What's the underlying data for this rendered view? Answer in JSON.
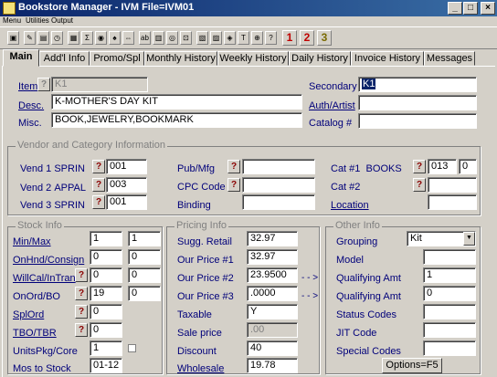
{
  "window": {
    "title": "Bookstore Manager - IVM    File=IVM01",
    "min": "_",
    "max": "□",
    "close": "×"
  },
  "menu": [
    "Menu",
    "Utilities",
    "Output"
  ],
  "toolbar": {
    "icons": [
      "save-icon",
      "print-icon",
      "folder-icon",
      "clock-icon",
      "grid-icon",
      "sum-icon",
      "camera-icon",
      "binoculars-icon",
      "arrows-icon",
      "abc-icon",
      "table-icon",
      "target-icon",
      "lock-icon",
      "chart-icon",
      "image-icon",
      "tag-icon",
      "text-icon",
      "circle-icon",
      "help-icon"
    ],
    "numbers": [
      "1",
      "2",
      "3"
    ],
    "glyphs": [
      "▣",
      "✎",
      "▤",
      "◷",
      "▦",
      "Σ",
      "◉",
      "♠",
      "⇔",
      "ab",
      "▥",
      "◎",
      "⊡",
      "▧",
      "▨",
      "◈",
      "T",
      "⊕",
      "?"
    ]
  },
  "tabs": [
    "Main",
    "Add'l Info",
    "Promo/Spl",
    "Monthly History",
    "Weekly History",
    "Daily History",
    "Invoice History",
    "Messages"
  ],
  "main": {
    "item": {
      "label": "Item",
      "value": "K1"
    },
    "desc": {
      "label": "Desc.",
      "value": "K-MOTHER'S DAY KIT"
    },
    "misc": {
      "label": "Misc.",
      "value": "BOOK,JEWELRY,BOOKMARK"
    },
    "secondary": {
      "label": "Secondary",
      "value": "K1"
    },
    "author": {
      "label": "Auth/Artist",
      "value": ""
    },
    "catalog": {
      "label": "Catalog #",
      "value": ""
    }
  },
  "vendor": {
    "title": "Vendor and Category Information",
    "vend1": {
      "label": "Vend 1",
      "code": "SPRIN",
      "value": "001"
    },
    "vend2": {
      "label": "Vend 2",
      "code": "APPAL",
      "value": "003"
    },
    "vend3": {
      "label": "Vend 3",
      "code": "SPRIN",
      "value": "001"
    },
    "pubmfg": {
      "label": "Pub/Mfg",
      "value": ""
    },
    "cpc": {
      "label": "CPC Code",
      "value": ""
    },
    "binding": {
      "label": "Binding",
      "value": ""
    },
    "cat1": {
      "label": "Cat #1",
      "code": "BOOKS",
      "value": "013",
      "value2": "0"
    },
    "cat2": {
      "label": "Cat #2",
      "value": ""
    },
    "location": {
      "label": "Location",
      "value": ""
    }
  },
  "stock": {
    "title": "Stock Info",
    "minmax": {
      "label": "Min/Max",
      "v1": "1",
      "v2": "1"
    },
    "onhnd": {
      "label": "OnHnd/Consign",
      "v1": "0",
      "v2": "0"
    },
    "willcall": {
      "label": "WillCal/InTran",
      "v1": "0",
      "v2": "0"
    },
    "onord": {
      "label": "OnOrd/BO",
      "v1": "19",
      "v2": "0"
    },
    "splord": {
      "label": "SplOrd",
      "v1": "0"
    },
    "tbo": {
      "label": "TBO/TBR",
      "v1": "0"
    },
    "units": {
      "label": "UnitsPkg/Core",
      "v1": "1"
    },
    "mos": {
      "label": "Mos to Stock",
      "v1": "01-12"
    }
  },
  "pricing": {
    "title": "Pricing Info",
    "sugg": {
      "label": "Sugg. Retail",
      "value": "32.97"
    },
    "price1": {
      "label": "Our Price #1",
      "value": "32.97"
    },
    "price2": {
      "label": "Our Price #2",
      "value": "23.9500"
    },
    "price3": {
      "label": "Our Price #3",
      "value": ".0000"
    },
    "taxable": {
      "label": "Taxable",
      "value": "Y"
    },
    "sale": {
      "label": "Sale price",
      "value": ".00"
    },
    "discount": {
      "label": "Discount",
      "value": "40"
    },
    "wholesale": {
      "label": "Wholesale",
      "value": "19.78"
    }
  },
  "other": {
    "title": "Other Info",
    "grouping": {
      "label": "Grouping",
      "value": "Kit"
    },
    "model": {
      "label": "Model",
      "value": ""
    },
    "qual1": {
      "arrow": "- - >",
      "label": "Qualifying Amt",
      "value": "1"
    },
    "qual2": {
      "arrow": "- - >",
      "label": "Qualifying Amt",
      "value": "0"
    },
    "status": {
      "label": "Status Codes",
      "value": ""
    },
    "jit": {
      "label": "JIT Code",
      "value": ""
    },
    "special": {
      "label": "Special Codes",
      "value": ""
    }
  },
  "options_button": "Options=F5",
  "q": "?"
}
